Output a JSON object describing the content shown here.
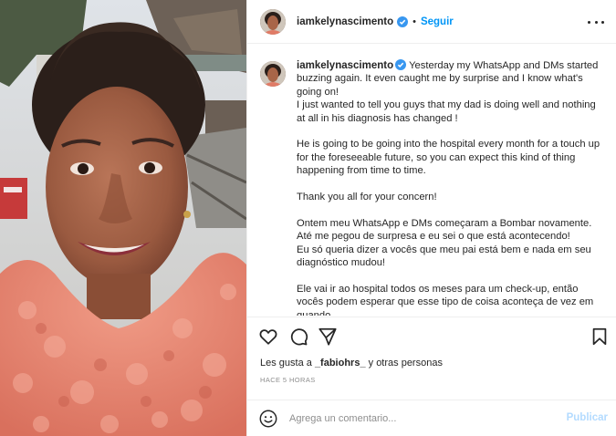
{
  "post": {
    "username": "iamkelynascimento",
    "separator": "•",
    "follow_label": "Seguir",
    "caption_paragraphs": [
      "Yesterday my WhatsApp and DMs started buzzing again. It even caught me by surprise and I know what's going on!",
      "I just wanted to tell you guys that my dad is doing well and nothing at all in his diagnosis has changed !",
      "",
      "He is going to be going into the hospital every month for a touch up for the foreseeable future, so you can expect this kind of thing happening from time to time.",
      "",
      "Thank you all for your concern!",
      "",
      "Ontem meu WhatsApp e DMs começaram a Bombar novamente. Até me pegou de surpresa e eu sei o que está acontecendo!",
      "Eu só queria dizer a vocês que meu pai está bem e nada em seu diagnóstico mudou!",
      "",
      "Ele vai ir ao hospital todos os meses para um check-up, então vocês podem esperar que esse tipo de coisa aconteça de vez em quando."
    ],
    "likes_prefix": "Les gusta a ",
    "likes_user": "_fabiohrs_",
    "likes_suffix": " y otras personas",
    "timestamp": "HACE 5 HORAS"
  },
  "comment": {
    "placeholder": "Agrega un comentario...",
    "publish_label": "Publicar"
  },
  "icons": {
    "like": "heart-icon",
    "comment": "comment-icon",
    "share": "send-icon",
    "save": "bookmark-icon",
    "more": "more-options-icon",
    "verified": "verified-badge-icon",
    "emoji": "emoji-icon"
  },
  "colors": {
    "link_blue": "#0095f6",
    "publish_disabled": "#b3dbff",
    "verified_blue": "#3897f0",
    "muted": "#8e8e8e"
  }
}
